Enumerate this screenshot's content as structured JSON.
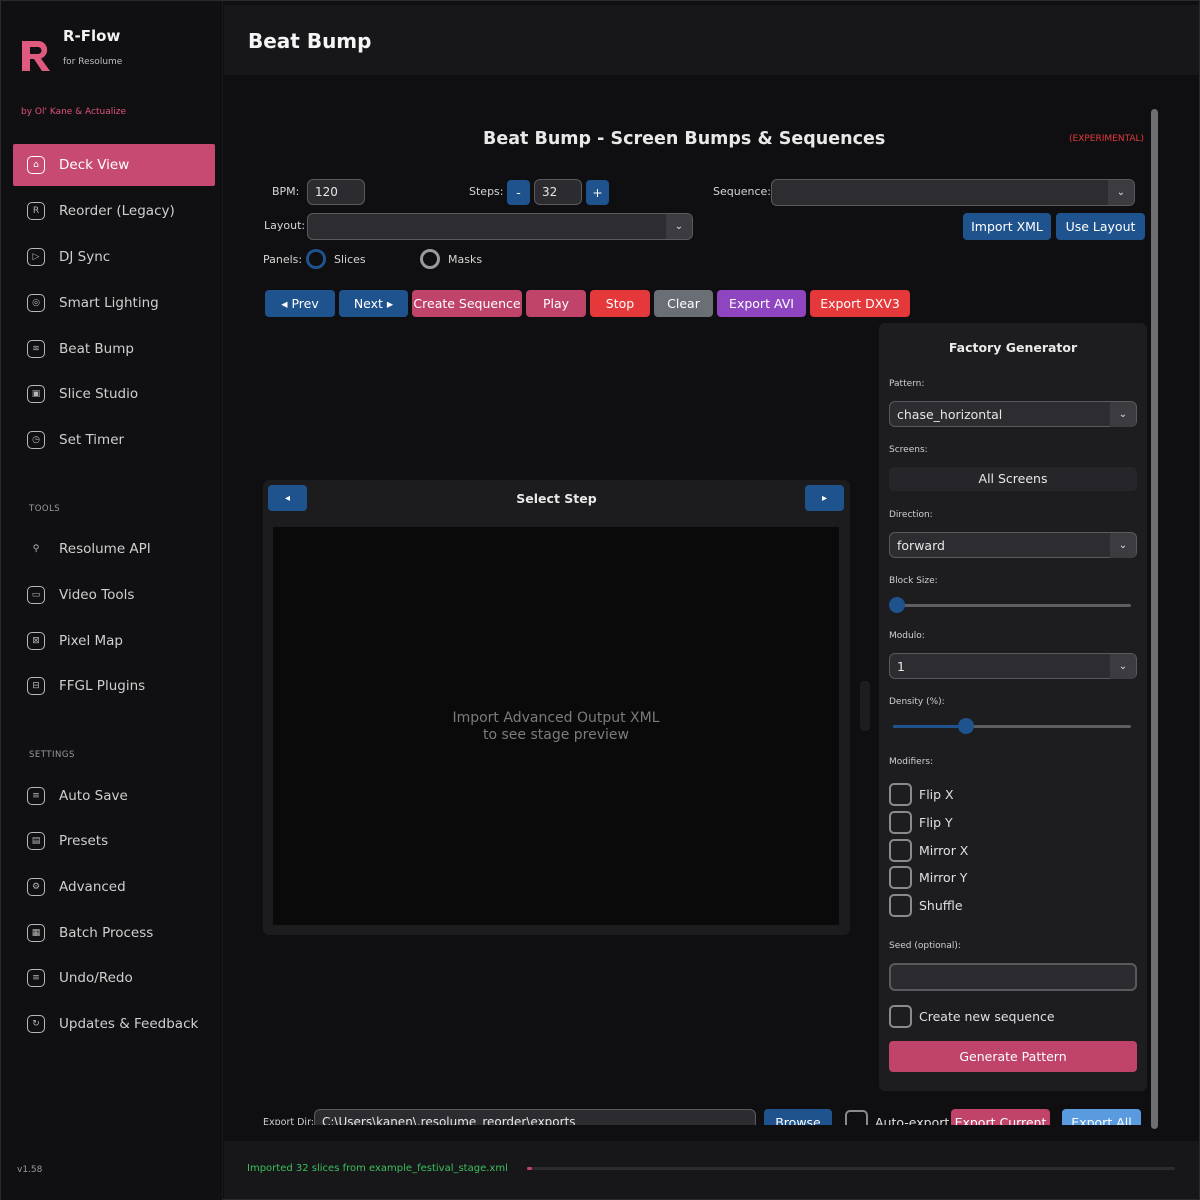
{
  "brand": {
    "name": "R-Flow",
    "subtitle": "for Resolume",
    "byline": "by Ol' Kane & Actualize",
    "version": "v1.58"
  },
  "sidebar": {
    "items": [
      {
        "label": "Deck View",
        "icon": "deck-icon",
        "active": true
      },
      {
        "label": "Reorder (Legacy)",
        "icon": "reorder-icon"
      },
      {
        "label": "DJ Sync",
        "icon": "dj-sync-icon"
      },
      {
        "label": "Smart Lighting",
        "icon": "lighting-icon"
      },
      {
        "label": "Beat Bump",
        "icon": "waveform-icon"
      },
      {
        "label": "Slice Studio",
        "icon": "slice-icon"
      },
      {
        "label": "Set Timer",
        "icon": "timer-icon"
      }
    ],
    "tools_label": "TOOLS",
    "tools": [
      {
        "label": "Resolume API",
        "icon": "api-icon"
      },
      {
        "label": "Video Tools",
        "icon": "video-icon"
      },
      {
        "label": "Pixel Map",
        "icon": "pixel-map-icon"
      },
      {
        "label": "FFGL Plugins",
        "icon": "plugin-icon"
      }
    ],
    "settings_label": "SETTINGS",
    "settings": [
      {
        "label": "Auto Save",
        "icon": "auto-save-icon"
      },
      {
        "label": "Presets",
        "icon": "presets-icon"
      },
      {
        "label": "Advanced",
        "icon": "advanced-icon"
      },
      {
        "label": "Batch Process",
        "icon": "batch-icon"
      },
      {
        "label": "Undo/Redo",
        "icon": "undo-icon"
      },
      {
        "label": "Updates & Feedback",
        "icon": "updates-icon"
      }
    ]
  },
  "header": {
    "title": "Beat Bump"
  },
  "main": {
    "title": "Beat Bump - Screen Bumps & Sequences",
    "experimental": "(EXPERIMENTAL)",
    "bpm_label": "BPM:",
    "bpm_value": "120",
    "steps_label": "Steps:",
    "steps_value": "32",
    "steps_minus": "-",
    "steps_plus": "+",
    "sequence_label": "Sequence:",
    "sequence_value": "",
    "layout_label": "Layout:",
    "layout_value": "",
    "import_xml": "Import XML",
    "use_layout": "Use Layout",
    "panels_label": "Panels:",
    "panel_slices": "Slices",
    "panel_masks": "Masks",
    "actions": {
      "prev": "◂ Prev",
      "next": "Next ▸",
      "create_sequence": "Create Sequence",
      "play": "Play",
      "stop": "Stop",
      "clear": "Clear",
      "export_avi": "Export AVI",
      "export_dxv3": "Export DXV3"
    },
    "step_selector": {
      "title": "Select Step",
      "prev_arrow": "◂",
      "next_arrow": "▸",
      "stage_line1": "Import Advanced Output XML",
      "stage_line2": "to see stage preview"
    },
    "export": {
      "dir_label": "Export Dir:",
      "dir_value": "C:\\Users\\kanen\\.resolume_reorder\\exports",
      "browse": "Browse",
      "auto_export": "Auto-export",
      "export_current": "Export Current",
      "export_all": "Export All"
    }
  },
  "factory": {
    "title": "Factory Generator",
    "pattern_label": "Pattern:",
    "pattern_value": "chase_horizontal",
    "screens_label": "Screens:",
    "screens_value": "All Screens",
    "direction_label": "Direction:",
    "direction_value": "forward",
    "block_size_label": "Block Size:",
    "block_size_level": 0,
    "modulo_label": "Modulo:",
    "modulo_value": "1",
    "density_label": "Density (%):",
    "density_level": 0.3,
    "modifiers_label": "Modifiers:",
    "modifiers": [
      "Flip X",
      "Flip Y",
      "Mirror X",
      "Mirror Y",
      "Shuffle"
    ],
    "seed_label": "Seed (optional):",
    "seed_value": "",
    "create_new_sequence": "Create new sequence",
    "generate": "Generate Pattern"
  },
  "status": {
    "message": "Imported 32 slices from example_festival_stage.xml",
    "progress": 0.01
  },
  "colors": {
    "accent": "#c74a72",
    "blue": "#1f538d",
    "red": "#e5383b",
    "purple": "#8f45c0",
    "status_green": "#3cbf5a"
  }
}
